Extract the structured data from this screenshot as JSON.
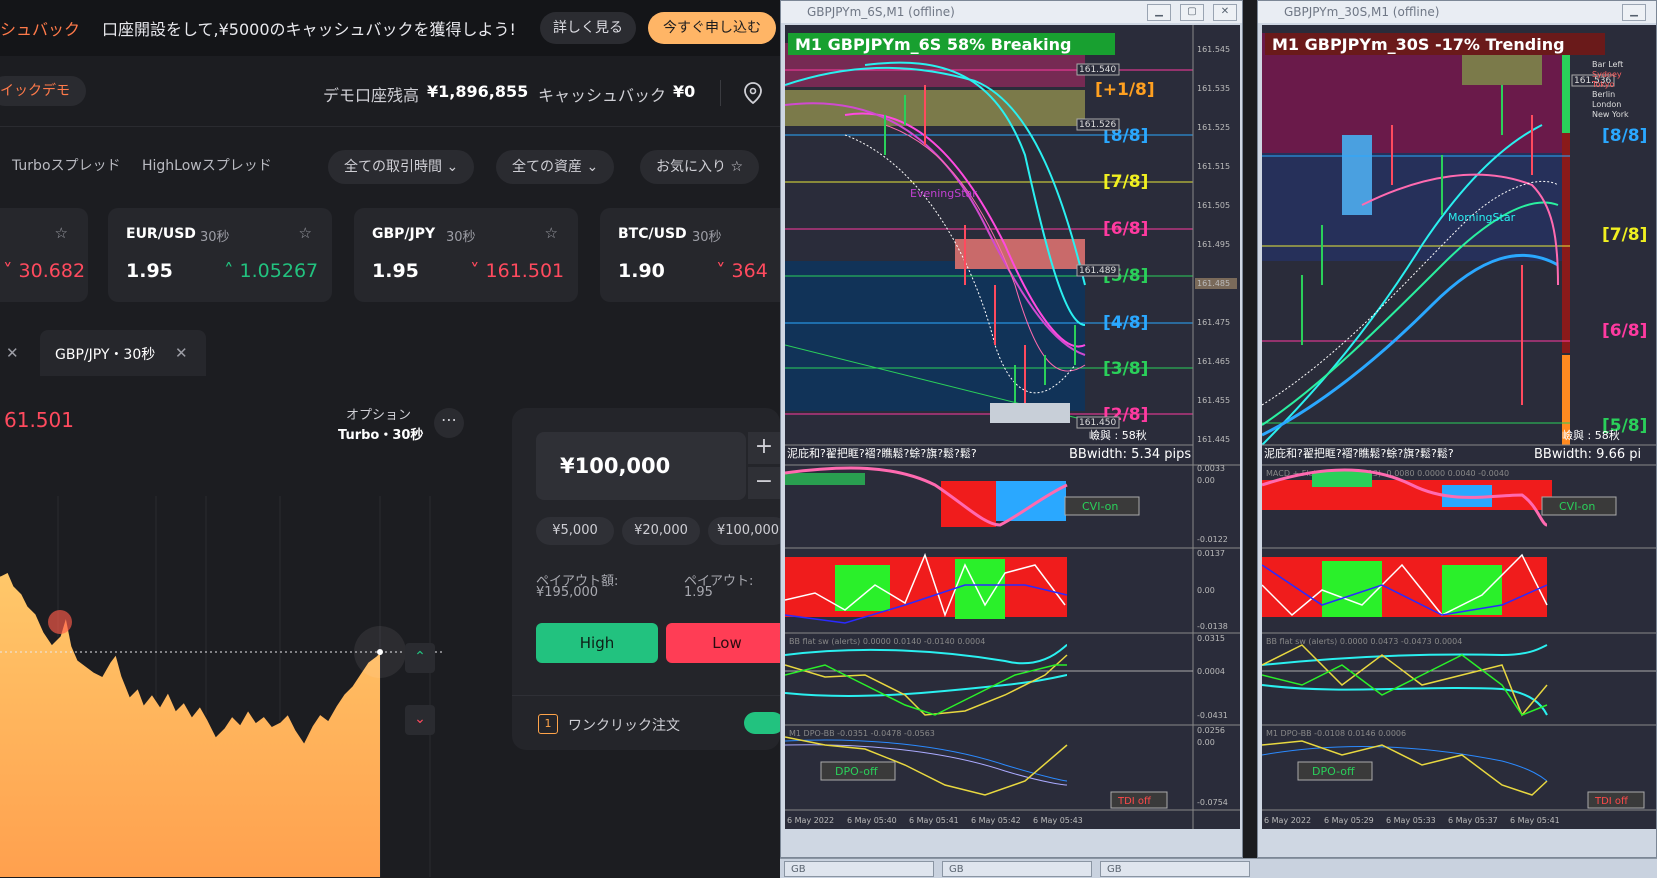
{
  "banner": {
    "left_text": "シュバック",
    "promo": "口座開設をして,¥5000のキャッシュバックを獲得しよう!",
    "detail_button": "詳しく見る",
    "apply_button": "今すぐ申し込む"
  },
  "account": {
    "demo_label": "イックデモ",
    "balance_label": "デモ口座残高",
    "balance_value": "¥1,896,855",
    "cashback_label": "キャッシュバック",
    "cashback_value": "¥0"
  },
  "filters": {
    "turbo_spread": "Turboスプレッド",
    "highlow_spread": "HighLowスプレッド",
    "time_dropdown": "全ての取引時間",
    "asset_dropdown": "全ての資産",
    "favorites": "お気に入り"
  },
  "cards": [
    {
      "pair": "",
      "duration": "",
      "payout": "",
      "price": "30.682",
      "direction": "down"
    },
    {
      "pair": "EUR/USD",
      "duration": "30秒",
      "payout": "1.95",
      "price": "1.05267",
      "direction": "up"
    },
    {
      "pair": "GBP/JPY",
      "duration": "30秒",
      "payout": "1.95",
      "price": "161.501",
      "direction": "down"
    },
    {
      "pair": "BTC/USD",
      "duration": "30秒",
      "payout": "1.90",
      "price": "364",
      "direction": "down"
    }
  ],
  "tab": {
    "active_label": "GBP/JPY・30秒"
  },
  "chart": {
    "current_price": "61.501",
    "option_label": "オプション",
    "option_value": "Turbo・30秒"
  },
  "order": {
    "amount": "¥100,000",
    "chips": [
      "¥5,000",
      "¥20,000",
      "¥100,000"
    ],
    "payout_amount_label": "ペイアウト額:",
    "payout_amount_value": "¥195,000",
    "payout_rate_label": "ペイアウト:",
    "payout_rate_value": "1.95",
    "high_label": "High",
    "low_label": "Low",
    "oneclick_label": "ワンクリック注文"
  },
  "mt4_left": {
    "window_title": "GBPJPYm_6S,M1 (offline)",
    "headline": "M1 GBPJPYm_6S 58% Breaking",
    "murrey": [
      "[+1/8]",
      "[8/8]",
      "[7/8]",
      "[6/8]",
      "[5/8]",
      "[4/8]",
      "[3/8]",
      "[2/8]"
    ],
    "price_boxes": [
      "161.540",
      "161.526",
      "161.489",
      "161.450"
    ],
    "price_axis": [
      "161.545",
      "161.535",
      "161.525",
      "161.515",
      "161.505",
      "161.495",
      "161.485",
      "161.475",
      "161.465",
      "161.455",
      "161.445"
    ],
    "ind_label": "泥庇和?翟把眶?褶?瞧鬆?蜍?旗?鬆?鬆?",
    "bbwidth": "BBwidth: 5.34 pips",
    "remaining": "嶮與 : 58秋",
    "pattern": "EveningStar",
    "macd_axis": [
      "0.0033",
      "0.00",
      "-0.0122"
    ],
    "osc_axis": [
      "0.0137",
      "0.00",
      "-0.0138"
    ],
    "bb_axis": [
      "0.0315",
      "0.0004",
      "-0.0431"
    ],
    "bb_label": "BB flat sw (alerts) 0.0000 0.0140 -0.0140 0.0004",
    "dpo_axis": [
      "0.0256",
      "0.00",
      "-0.0754"
    ],
    "dpo_label": "M1 DPO-BB -0.0351 -0.0478 -0.0563",
    "cvi": "CVI-on",
    "dpo": "DPO-off",
    "tdi": "TDI off",
    "time_axis": [
      "6 May 2022",
      "6 May 05:40",
      "6 May 05:41",
      "6 May 05:42",
      "6 May 05:43"
    ]
  },
  "mt4_right": {
    "window_title": "GBPJPYm_30S,M1 (offline)",
    "headline": "M1 GBPJPYm_30S -17% Trending",
    "murrey": [
      "[8/8]",
      "[7/8]",
      "[6/8]",
      "[5/8]"
    ],
    "price_boxes": [
      "161.536"
    ],
    "sessions": [
      "Bar Left",
      "Sydney",
      "Tokyo",
      "Berlin",
      "London",
      "New York"
    ],
    "ind_label": "泥庇和?翟把眶?褶?瞧鬆?蜍?旗?鬆?鬆?",
    "bbwidth": "BBwidth: 9.66 pi",
    "remaining": "嶮與 : 58秋",
    "pattern": "MorningStar",
    "macd_label": "MACD + Flat Indicator (8,13) -0.0080 0.0000 0.0040 -0.0040",
    "bb_label": "BB flat sw (alerts) 0.0000 0.0473 -0.0473 0.0004",
    "dpo_label": "M1 DPO-BB -0.0108 0.0146 0.0006",
    "cvi": "CVI-on",
    "dpo": "DPO-off",
    "tdi": "TDI off",
    "time_axis": [
      "6 May 2022",
      "6 May 05:29",
      "6 May 05:33",
      "6 May 05:37",
      "6 May 05:41"
    ]
  },
  "taskbar": [
    "GB",
    "GB",
    "GB"
  ]
}
